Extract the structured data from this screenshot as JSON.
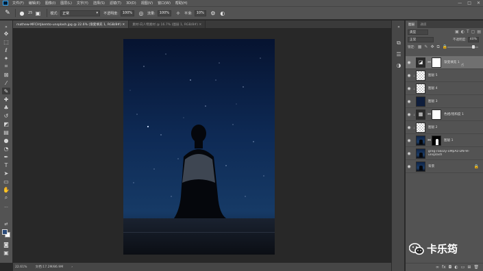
{
  "menu": {
    "items": [
      "文件(F)",
      "编辑(E)",
      "图像(I)",
      "图层(L)",
      "文字(Y)",
      "选择(S)",
      "滤镜(T)",
      "3D(D)",
      "视图(V)",
      "窗口(W)",
      "帮助(H)"
    ],
    "window_controls": [
      "—",
      "□",
      "✕"
    ]
  },
  "options": {
    "brush_size": "25",
    "mode_label": "模式:",
    "mode_value": "正常",
    "opacity_label": "不透明度:",
    "opacity_value": "100%",
    "flow_label": "流量:",
    "flow_value": "100%",
    "smoothing_label": "平滑:",
    "smoothing_value": "10%"
  },
  "tabs": [
    {
      "label": "mathew-MFCHtjkemto-unsplash.jpg @ 22.6% (渐变填充 1, RGB/8#) ✕",
      "active": true
    },
    {
      "label": "素材-向人物素材 @ 16.7% (图层 1, RGB/8#) ✕",
      "active": false
    }
  ],
  "status": {
    "zoom": "22.61%",
    "doc_info": "文档:17.2M/86.9M",
    "arrow": "›"
  },
  "panel": {
    "tabs": [
      "图层",
      "通道"
    ],
    "kind_label": "类型",
    "blend_mode": "正常",
    "opacity_label": "不透明度:",
    "opacity_value": "40%",
    "lock_label": "锁定:",
    "fill_label": "填充:",
    "fill_value": "100%"
  },
  "layers": [
    {
      "name": "渐变填充 1",
      "thumb": "adj",
      "mask": "white",
      "selected": true,
      "lock": false
    },
    {
      "name": "图层 5",
      "thumb": "trans",
      "mask": "",
      "selected": false,
      "lock": false
    },
    {
      "name": "图层 4",
      "thumb": "trans",
      "mask": "",
      "selected": false,
      "lock": false
    },
    {
      "name": "图层 3",
      "thumb": "navy",
      "mask": "",
      "selected": false,
      "lock": false
    },
    {
      "name": "色相/饱和度 1",
      "thumb": "adj",
      "mask": "white",
      "selected": false,
      "lock": false
    },
    {
      "name": "图层 2",
      "thumb": "trans",
      "mask": "",
      "selected": false,
      "lock": false
    },
    {
      "name": "图层 1",
      "thumb": "photo",
      "mask": "mask",
      "selected": false,
      "lock": false
    },
    {
      "name": "greg-rakozy-oMpAz-DN-9I-unsplash",
      "thumb": "photo",
      "mask": "",
      "selected": false,
      "lock": false
    },
    {
      "name": "背景",
      "thumb": "photo",
      "mask": "",
      "selected": false,
      "lock": true
    }
  ],
  "watermark": {
    "text": "卡乐筠"
  },
  "colors": {
    "foreground": "#2b4a78",
    "background": "#ffffff",
    "canvas_bg": "#282828"
  }
}
